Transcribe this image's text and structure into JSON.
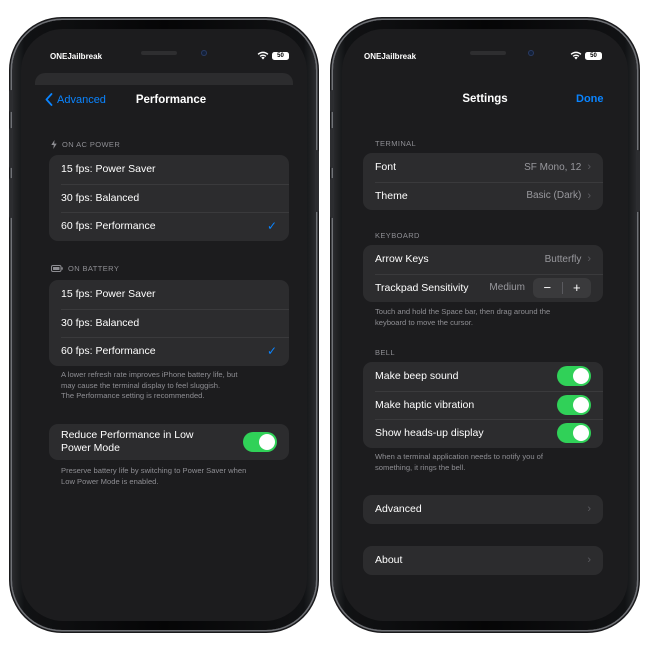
{
  "left": {
    "carrier": "ONEJailbreak",
    "battery": "50",
    "nav": {
      "back_label": "Advanced",
      "title": "Performance"
    },
    "ac_section": {
      "header": "ON AC POWER",
      "icon": "bolt-icon",
      "items": [
        {
          "label": "15 fps: Power Saver",
          "checked": false
        },
        {
          "label": "30 fps: Balanced",
          "checked": false
        },
        {
          "label": "60 fps: Performance",
          "checked": true
        }
      ]
    },
    "battery_section": {
      "header": "ON BATTERY",
      "icon": "battery-icon",
      "items": [
        {
          "label": "15 fps: Power Saver",
          "checked": false
        },
        {
          "label": "30 fps: Balanced",
          "checked": false
        },
        {
          "label": "60 fps: Performance",
          "checked": true
        }
      ],
      "footer_lines": [
        "A lower refresh rate improves iPhone battery life, but",
        "may cause the terminal display to feel sluggish.",
        "The Performance setting is recommended."
      ]
    },
    "low_power": {
      "label_lines": [
        "Reduce Performance in Low",
        "Power Mode"
      ],
      "enabled": true,
      "footer_lines": [
        "Preserve battery life by switching to Power Saver when",
        "Low Power Mode is enabled."
      ]
    }
  },
  "right": {
    "carrier": "ONEJailbreak",
    "battery": "50",
    "nav": {
      "title": "Settings",
      "done_label": "Done"
    },
    "terminal": {
      "header": "TERMINAL",
      "font_label": "Font",
      "font_value": "SF Mono, 12",
      "theme_label": "Theme",
      "theme_value": "Basic (Dark)"
    },
    "keyboard": {
      "header": "KEYBOARD",
      "arrow_label": "Arrow Keys",
      "arrow_value": "Butterfly",
      "trackpad_label": "Trackpad Sensitivity",
      "trackpad_value": "Medium",
      "minus": "−",
      "plus": "+",
      "footer_lines": [
        "Touch and hold the Space bar, then drag around the",
        "keyboard to move the cursor."
      ]
    },
    "bell": {
      "header": "BELL",
      "items": [
        {
          "label": "Make beep sound",
          "enabled": true
        },
        {
          "label": "Make haptic vibration",
          "enabled": true
        },
        {
          "label": "Show heads-up display",
          "enabled": true
        }
      ],
      "footer_lines": [
        "When a terminal application needs to notify you of",
        "something, it rings the bell."
      ]
    },
    "advanced_label": "Advanced",
    "about_label": "About"
  },
  "colors": {
    "accent": "#0a84ff",
    "toggle_on": "#30d158",
    "background": "#1c1c1e",
    "cell": "#2c2c2e"
  }
}
